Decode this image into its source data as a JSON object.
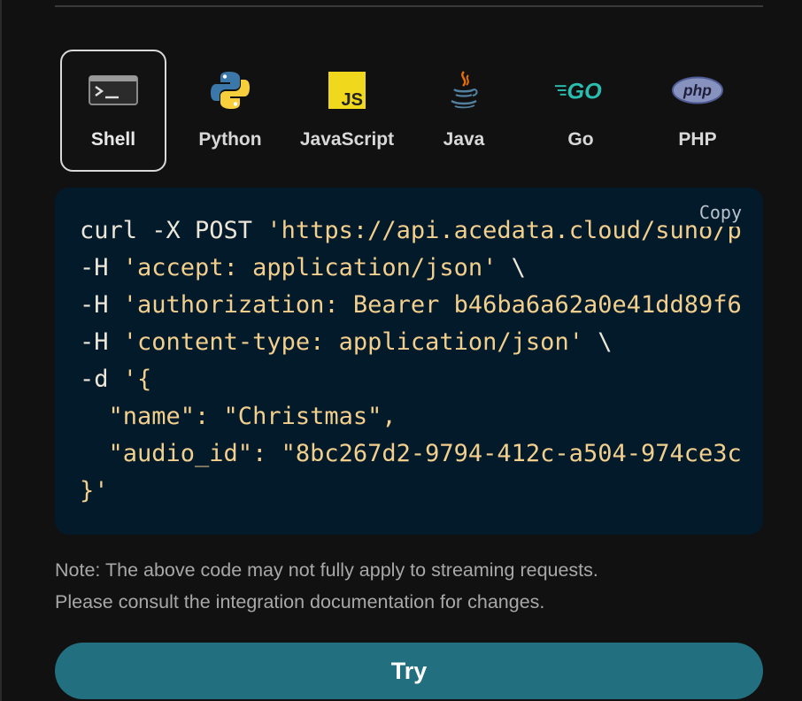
{
  "languages": [
    {
      "label": "Shell",
      "icon": "terminal-icon",
      "active": true
    },
    {
      "label": "Python",
      "icon": "python-icon",
      "active": false
    },
    {
      "label": "JavaScript",
      "icon": "javascript-icon",
      "active": false
    },
    {
      "label": "Java",
      "icon": "java-icon",
      "active": false
    },
    {
      "label": "Go",
      "icon": "go-icon",
      "active": false
    },
    {
      "label": "PHP",
      "icon": "php-icon",
      "active": false
    }
  ],
  "code_panel": {
    "copy_label": "Copy",
    "lines": [
      [
        {
          "text": "curl -X POST ",
          "type": "plain"
        },
        {
          "text": "'https://api.acedata.cloud/suno/p",
          "type": "str"
        }
      ],
      [
        {
          "text": "-H ",
          "type": "plain"
        },
        {
          "text": "'accept: application/json'",
          "type": "str"
        },
        {
          "text": " \\",
          "type": "plain"
        }
      ],
      [
        {
          "text": "-H ",
          "type": "plain"
        },
        {
          "text": "'authorization: Bearer b46ba6a62a0e41dd89f6",
          "type": "str"
        }
      ],
      [
        {
          "text": "-H ",
          "type": "plain"
        },
        {
          "text": "'content-type: application/json'",
          "type": "str"
        },
        {
          "text": " \\",
          "type": "plain"
        }
      ],
      [
        {
          "text": "-d ",
          "type": "plain"
        },
        {
          "text": "'{",
          "type": "str"
        }
      ],
      [
        {
          "text": "  \"name\": \"Christmas\",",
          "type": "str"
        }
      ],
      [
        {
          "text": "  \"audio_id\": \"8bc267d2-9794-412c-a504-974ce3c",
          "type": "str"
        }
      ],
      [
        {
          "text": "}'",
          "type": "str"
        }
      ]
    ]
  },
  "note": {
    "line1": "Note: The above code may not fully apply to streaming requests.",
    "line2": "Please consult the integration documentation for changes."
  },
  "try_label": "Try",
  "colors": {
    "background": "#111111",
    "code_background": "#031a2b",
    "string": "#f2cf8d",
    "try_button": "#226f80"
  }
}
